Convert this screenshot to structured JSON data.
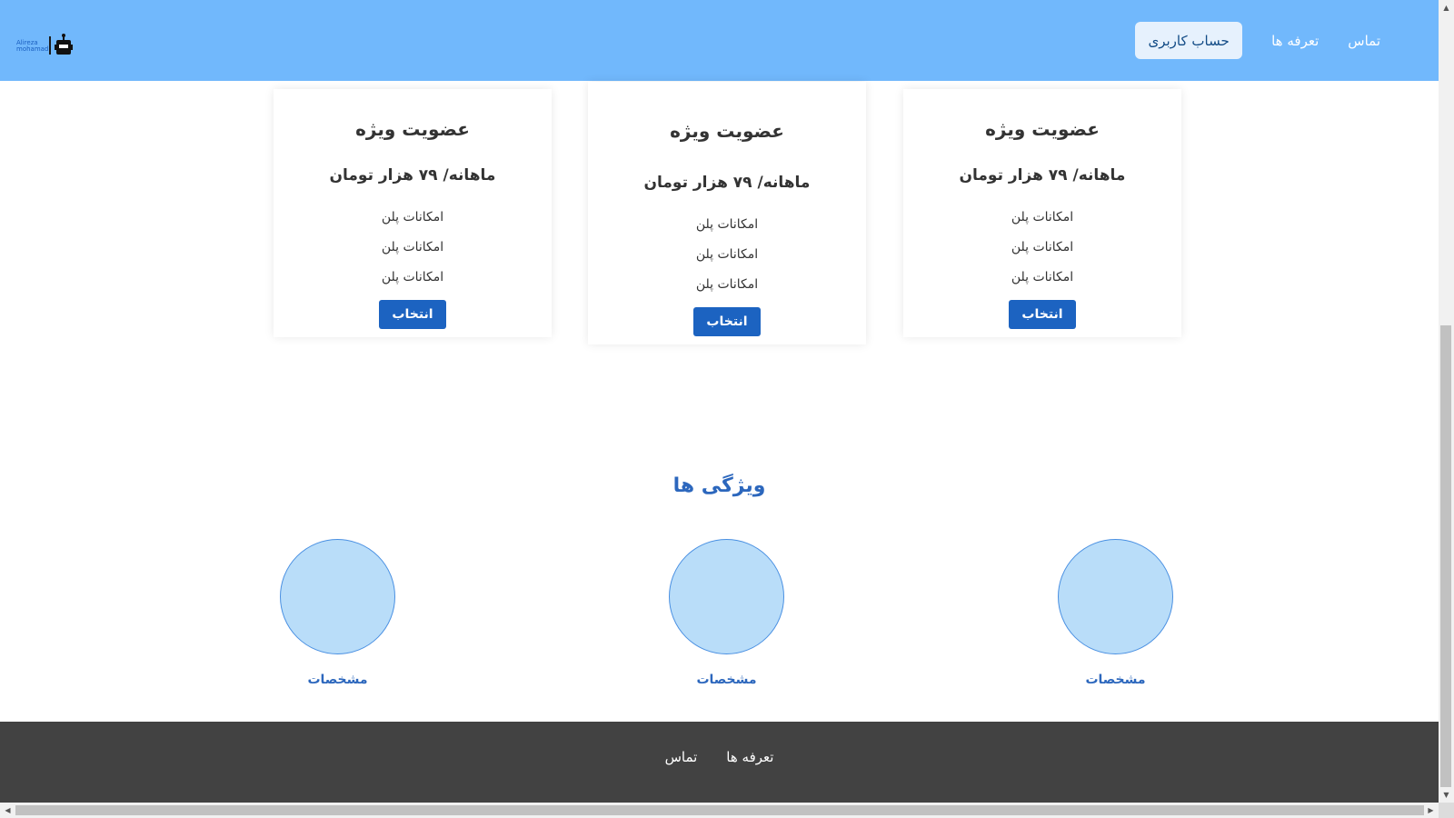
{
  "header": {
    "logo": {
      "line1": "Alireza",
      "line2": "mohamadi",
      "icon": "robot-icon"
    },
    "nav": {
      "account": "حساب کاربری",
      "plans": "تعرفه ها",
      "contact": "تماس"
    },
    "color": "#71b8fc"
  },
  "plans": [
    {
      "title": "عضویت ویژه",
      "price": "ماهانه/ ۷۹ هزار تومان",
      "features": [
        "امکانات پلن",
        "امکانات پلن",
        "امکانات پلن"
      ],
      "button": "انتخاب"
    },
    {
      "title": "عضویت ویژه",
      "price": "ماهانه/ ۷۹ هزار تومان",
      "features": [
        "امکانات پلن",
        "امکانات پلن",
        "امکانات پلن"
      ],
      "button": "انتخاب"
    },
    {
      "title": "عضویت ویژه",
      "price": "ماهانه/ ۷۹ هزار تومان",
      "features": [
        "امکانات پلن",
        "امکانات پلن",
        "امکانات پلن"
      ],
      "button": "انتخاب"
    }
  ],
  "features_section": {
    "title": "ویژگی ها",
    "items": [
      {
        "label": "مشخصات"
      },
      {
        "label": "مشخصات"
      },
      {
        "label": "مشخصات"
      }
    ]
  },
  "footer": {
    "plans": "تعرفه ها",
    "contact": "تماس",
    "color": "#424242"
  },
  "colors": {
    "accent": "#1c63c1",
    "heading": "#2c67bd",
    "circle": "#b9ddf9"
  }
}
